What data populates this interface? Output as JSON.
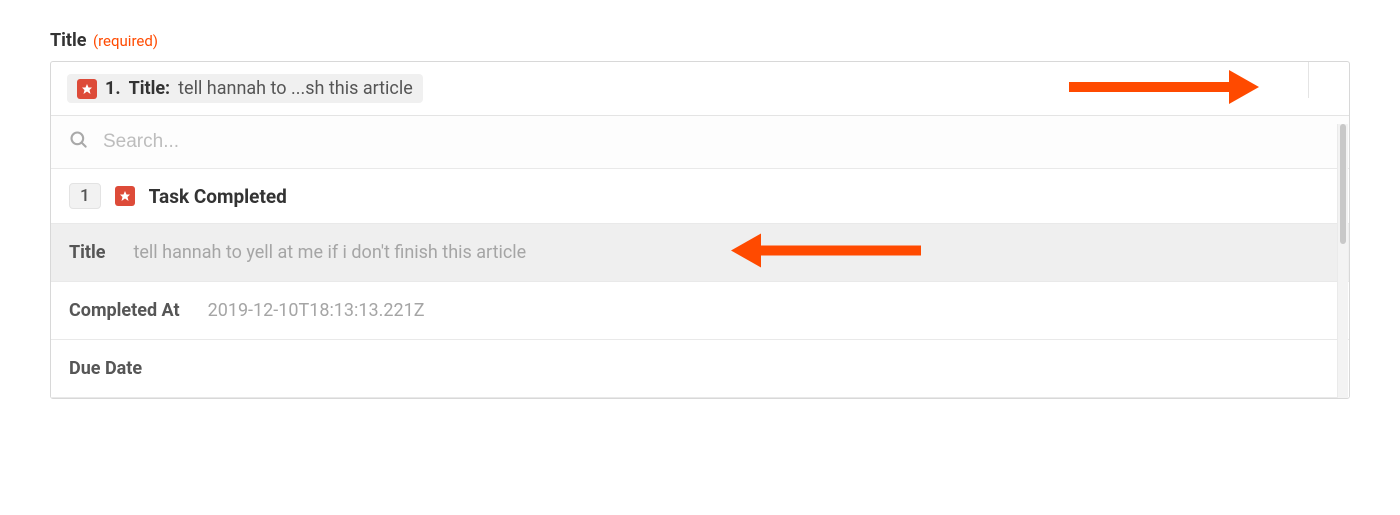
{
  "field": {
    "label": "Title",
    "required_text": "(required)"
  },
  "token": {
    "index": "1.",
    "label": "Title:",
    "value": "tell hannah to ...sh this article"
  },
  "search": {
    "placeholder": "Search..."
  },
  "heading": {
    "index": "1",
    "label": "Task Completed"
  },
  "rows": {
    "title": {
      "key": "Title",
      "value": "tell hannah to yell at me if i don't finish this article"
    },
    "completed_at": {
      "key": "Completed At",
      "value": "2019-12-10T18:13:13.221Z"
    },
    "due_date": {
      "key": "Due Date",
      "value": ""
    }
  },
  "colors": {
    "accent": "#ff4a00",
    "icon_bg": "#dd4b39"
  }
}
